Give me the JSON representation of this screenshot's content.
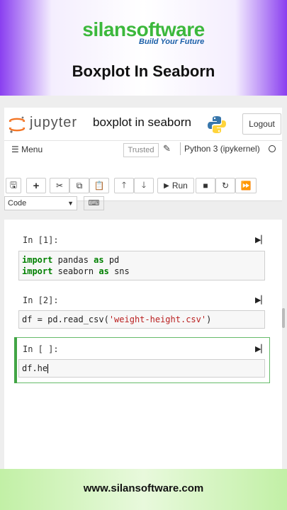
{
  "banner": {
    "logo_text": "silansoftware",
    "tagline": "Build Your Future",
    "title": "Boxplot In Seaborn"
  },
  "jupyter": {
    "brand": "jupyter",
    "notebook_title": "boxplot in seaborn",
    "logout_label": "Logout",
    "menu_label": "Menu",
    "trusted_label": "Trusted",
    "kernel_label": "Python 3 (ipykernel)",
    "run_label": "Run",
    "cell_type": "Code"
  },
  "cells": [
    {
      "prompt": "In [1]:",
      "lines": [
        [
          "import",
          " pandas ",
          "as",
          " pd"
        ],
        [
          "import",
          " seaborn ",
          "as",
          " sns"
        ]
      ]
    },
    {
      "prompt": "In [2]:",
      "code_prefix": "df = pd.read_csv(",
      "code_string": "'weight-height.csv'",
      "code_suffix": ")"
    },
    {
      "prompt": "In [ ]:",
      "code": "df.he"
    }
  ],
  "footer": {
    "url": "www.silansoftware.com"
  },
  "colors": {
    "accent_purple": "#8a3ff0",
    "jupyter_orange": "#f37626",
    "selected_cell": "#42a545",
    "keyword": "#008000",
    "string": "#ba2121"
  },
  "icons": [
    "jupyter-logo-icon",
    "python-logo-icon",
    "menu-icon",
    "pencil-icon",
    "kernel-status-icon",
    "save-icon",
    "add-cell-icon",
    "cut-icon",
    "copy-icon",
    "paste-icon",
    "move-up-icon",
    "move-down-icon",
    "run-icon",
    "stop-icon",
    "restart-icon",
    "fast-forward-icon",
    "keyboard-icon",
    "run-cell-icon"
  ]
}
